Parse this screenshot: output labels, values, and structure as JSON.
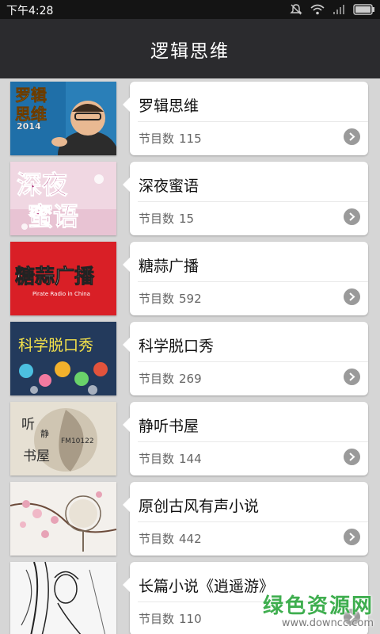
{
  "status_bar": {
    "time": "下午4:28"
  },
  "header": {
    "title": "逻辑思维"
  },
  "list": {
    "count_label": "节目数",
    "items": [
      {
        "title": "罗辑思维",
        "count": "115"
      },
      {
        "title": "深夜蜜语",
        "count": "15"
      },
      {
        "title": "糖蒜广播",
        "count": "592"
      },
      {
        "title": "科学脱口秀",
        "count": "269"
      },
      {
        "title": "静听书屋",
        "count": "144"
      },
      {
        "title": "原创古风有声小说",
        "count": "442"
      },
      {
        "title": "长篇小说《逍遥游》",
        "count": "110"
      }
    ]
  },
  "thumbnails": [
    {
      "texts": [
        "罗辑",
        "思维",
        "2014"
      ]
    },
    {
      "texts": [
        "深夜",
        "蜜语"
      ]
    },
    {
      "texts": [
        "糖蒜广播",
        "Pirate Radio in China"
      ]
    },
    {
      "texts": [
        "科学脱口秀"
      ]
    },
    {
      "texts": [
        "听",
        "静",
        "书屋",
        "FM10122"
      ]
    },
    {
      "texts": []
    },
    {
      "texts": []
    }
  ],
  "watermark": {
    "title": "绿色资源网",
    "url": "www.downcc.com"
  },
  "colors": {
    "header_bg": "#2b2b2e",
    "status_bg": "#141414",
    "list_bg": "#d6d6d6",
    "watermark": "#3fae4f"
  }
}
